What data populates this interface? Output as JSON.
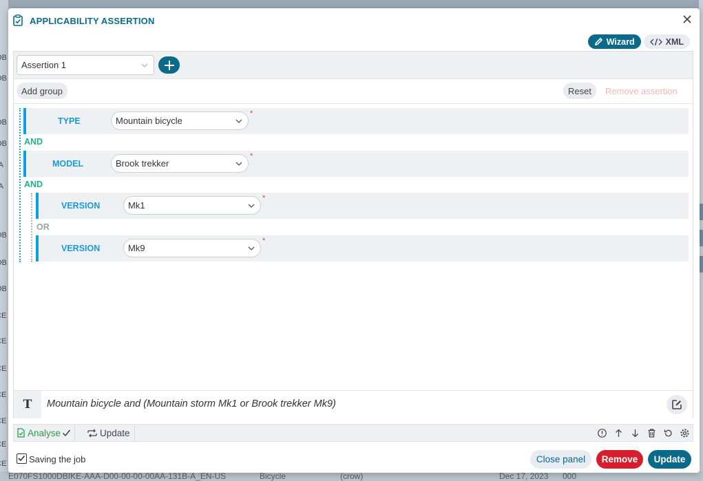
{
  "background": {
    "left_fragments": [
      "OB",
      "OB",
      "OB",
      "OB",
      "-A",
      "-A",
      "OB",
      "OB",
      "OB",
      "CE",
      "CE",
      "CE",
      "CE",
      "CE",
      "CE",
      "CE"
    ],
    "bottom_fragments": [
      "E070FS1000DBIKE-AAA-D00-00-00-00AA-131B-A_EN-US",
      "Bicycle",
      "(crow)",
      "Dec 17, 2023",
      "000"
    ]
  },
  "dialog": {
    "title": "APPLICABILITY ASSERTION",
    "title_icon": "clipboard-check-icon",
    "close_icon": "close-icon"
  },
  "mode": {
    "wizard_label": "Wizard",
    "xml_label": "XML",
    "active": "wizard"
  },
  "assertion_select": {
    "value": "Assertion 1"
  },
  "toolbar": {
    "add_group_label": "Add group",
    "reset_label": "Reset",
    "remove_assertion_label": "Remove assertion"
  },
  "tree": {
    "rows": [
      {
        "label": "TYPE",
        "value": "Mountain bicycle",
        "required": "*"
      },
      {
        "label": "MODEL",
        "value": "Brook trekker",
        "required": "*"
      },
      {
        "label": "VERSION",
        "value": "Mk1",
        "required": "*"
      },
      {
        "label": "VERSION",
        "value": "Mk9",
        "required": "*"
      }
    ],
    "operators": {
      "and1": "AND",
      "and2": "AND",
      "or1": "OR"
    }
  },
  "expression": {
    "icon_letter": "T",
    "text": "Mountain bicycle and (Mountain storm Mk1 or Brook trekker Mk9)"
  },
  "actionbar": {
    "analyse_label": "Analyse",
    "update_label": "Update",
    "icons": [
      "info-icon",
      "arrow-up-icon",
      "arrow-down-icon",
      "trash-icon",
      "undo-icon",
      "settings-icon"
    ]
  },
  "footer": {
    "checkbox_label": "Saving the job",
    "checkbox_checked": true,
    "close_panel_label": "Close panel",
    "remove_label": "Remove",
    "update_label": "Update"
  },
  "colors": {
    "accent": "#0b6a8a",
    "row_bar": "#0aa0e6",
    "and_operator": "#1fb08e",
    "danger": "#d81e2c"
  }
}
